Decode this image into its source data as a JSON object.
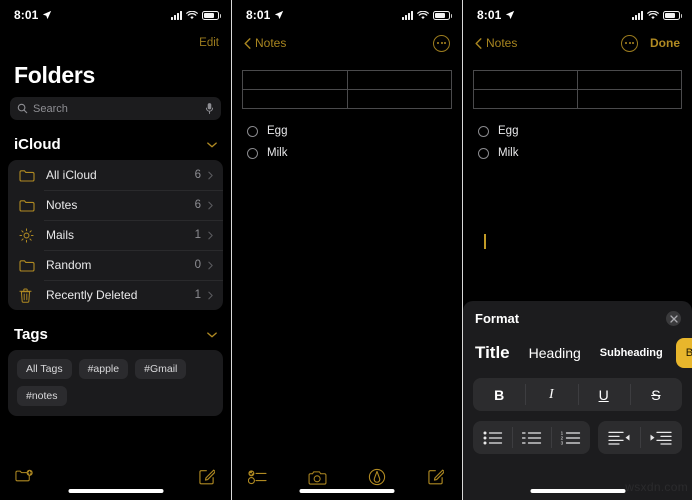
{
  "statusbar": {
    "time": "8:01",
    "location_icon": "location-arrow-icon",
    "cellular_icon": "cellular-bars-icon",
    "wifi_icon": "wifi-icon",
    "battery_icon": "battery-icon"
  },
  "panel1": {
    "nav": {
      "edit_label": "Edit"
    },
    "title": "Folders",
    "search": {
      "placeholder": "Search",
      "icon": "search-icon",
      "mic_icon": "microphone-icon"
    },
    "sections": [
      {
        "header": "iCloud",
        "collapse_icon": "chevron-down-icon",
        "rows": [
          {
            "icon": "folder-icon",
            "label": "All iCloud",
            "count": "6",
            "chevron": "chevron-right-icon"
          },
          {
            "icon": "folder-icon",
            "label": "Notes",
            "count": "6",
            "chevron": "chevron-right-icon"
          },
          {
            "icon": "gear-icon",
            "label": "Mails",
            "count": "1",
            "chevron": "chevron-right-icon"
          },
          {
            "icon": "folder-icon",
            "label": "Random",
            "count": "0",
            "chevron": "chevron-right-icon"
          },
          {
            "icon": "trash-icon",
            "label": "Recently Deleted",
            "count": "1",
            "chevron": "chevron-right-icon"
          }
        ]
      }
    ],
    "tags_section": {
      "header": "Tags",
      "collapse_icon": "chevron-down-icon",
      "tags": [
        "All Tags",
        "#apple",
        "#Gmail",
        "#notes"
      ]
    },
    "toolbar": {
      "new_folder_icon": "new-folder-icon",
      "compose_icon": "compose-icon"
    }
  },
  "panel2": {
    "nav": {
      "back_label": "Notes",
      "back_icon": "chevron-left-icon",
      "more_icon": "ellipsis-circle-icon"
    },
    "note": {
      "table": {
        "rows": 2,
        "cols": 2,
        "cells": [
          [
            "",
            ""
          ],
          [
            "",
            ""
          ]
        ]
      },
      "checklist": [
        {
          "checked": false,
          "text": "Egg"
        },
        {
          "checked": false,
          "text": "Milk"
        }
      ]
    },
    "toolbar": {
      "checklist_icon": "checklist-icon",
      "camera_icon": "camera-icon",
      "markup_icon": "markup-pen-icon",
      "compose_icon": "compose-icon"
    }
  },
  "panel3": {
    "nav": {
      "back_label": "Notes",
      "back_icon": "chevron-left-icon",
      "more_icon": "ellipsis-circle-icon",
      "done_label": "Done"
    },
    "note": {
      "table": {
        "rows": 2,
        "cols": 2,
        "cells": [
          [
            "",
            ""
          ],
          [
            "",
            ""
          ]
        ]
      },
      "checklist": [
        {
          "checked": false,
          "text": "Egg"
        },
        {
          "checked": false,
          "text": "Milk"
        }
      ],
      "caret": true
    },
    "format_sheet": {
      "title": "Format",
      "close_icon": "close-icon",
      "styles": [
        {
          "label": "Title",
          "selected": false
        },
        {
          "label": "Heading",
          "selected": false
        },
        {
          "label": "Subheading",
          "selected": false
        },
        {
          "label": "Body",
          "selected": true
        }
      ],
      "text_styles": [
        {
          "label": "B",
          "name": "bold-button"
        },
        {
          "label": "I",
          "name": "italic-button"
        },
        {
          "label": "U",
          "name": "underline-button"
        },
        {
          "label": "S",
          "name": "strikethrough-button"
        }
      ],
      "list_buttons": [
        {
          "name": "bulleted-list-button",
          "icon": "bulleted-list-icon"
        },
        {
          "name": "dashed-list-button",
          "icon": "dashed-list-icon"
        },
        {
          "name": "numbered-list-button",
          "icon": "numbered-list-icon"
        }
      ],
      "indent_buttons": [
        {
          "name": "outdent-button",
          "icon": "outdent-icon"
        },
        {
          "name": "indent-button",
          "icon": "indent-icon"
        }
      ],
      "accent_color": "#e8b62c"
    }
  },
  "watermark": "wsxdn.com",
  "colors": {
    "background": "#000000",
    "accent_gold": "#b08a22",
    "card": "#1b1b1d",
    "sheet": "#1c1c1e",
    "highlight": "#e8b62c"
  }
}
